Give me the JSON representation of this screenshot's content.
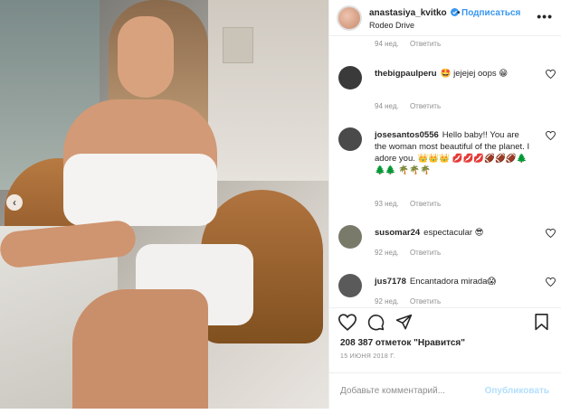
{
  "header": {
    "username": "anastasiya_kvitko",
    "follow_label": "Подписаться",
    "dot": "•",
    "location": "Rodeo Drive",
    "more_icon": "•••"
  },
  "photo": {
    "prev_label": "‹"
  },
  "top_meta": {
    "time": "94 нед.",
    "reply": "Ответить"
  },
  "comments": [
    {
      "user": "thebigpaulperu",
      "text": "🤩 jejejej oops 😁",
      "time": "94 нед.",
      "reply": "Ответить",
      "avatar_color": "#3a3a3a"
    },
    {
      "user": "josesantos0556",
      "text": "Hello baby!! You are the woman most beautiful of the planet. I adore you. 👑👑👑 💋💋💋🏈🏈🏈🌲🌲🌲 🌴🌴🌴",
      "time": "93 нед.",
      "reply": "Ответить",
      "avatar_color": "#4a4a4a"
    },
    {
      "user": "susomar24",
      "text": "espectacular 😎",
      "time": "92 нед.",
      "reply": "Ответить",
      "avatar_color": "#7a7a6a"
    },
    {
      "user": "jus7178",
      "text": "Encantadora mirada😱",
      "time": "92 нед.",
      "reply": "Ответить",
      "avatar_color": "#5a5a5a"
    }
  ],
  "likes": "208 387 отметок \"Нравится\"",
  "date": "15 ИЮНЯ 2018 Г.",
  "add_comment": {
    "placeholder": "Добавьте комментарий...",
    "publish": "Опубликовать"
  },
  "colors": {
    "accent": "#3897f0",
    "muted": "#8e8e8e",
    "publish_disabled": "#b2dffc"
  }
}
